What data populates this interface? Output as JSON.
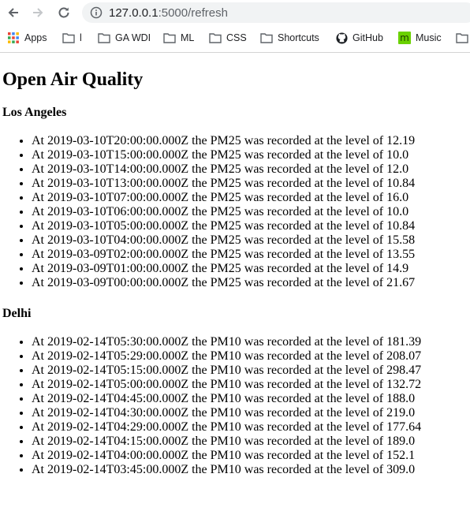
{
  "browser": {
    "url_host": "127.0.0.1",
    "url_path": ":5000/refresh",
    "bookmarks": [
      {
        "label": "Apps",
        "icon": "apps-grid-icon"
      },
      {
        "label": "l",
        "icon": "folder-icon"
      },
      {
        "label": "GA WDI",
        "icon": "folder-icon"
      },
      {
        "label": "ML",
        "icon": "folder-icon"
      },
      {
        "label": "CSS",
        "icon": "folder-icon"
      },
      {
        "label": "Shortcuts",
        "icon": "folder-icon"
      },
      {
        "label": "GitHub",
        "icon": "github-icon"
      },
      {
        "label": "Music",
        "icon": "music-m-icon"
      },
      {
        "label": "",
        "icon": "folder-icon"
      }
    ]
  },
  "page": {
    "title": "Open Air Quality",
    "cities": [
      {
        "name": "Los Angeles",
        "readings": [
          "At 2019-03-10T20:00:00.000Z the PM25 was recorded at the level of 12.19",
          "At 2019-03-10T15:00:00.000Z the PM25 was recorded at the level of 10.0",
          "At 2019-03-10T14:00:00.000Z the PM25 was recorded at the level of 12.0",
          "At 2019-03-10T13:00:00.000Z the PM25 was recorded at the level of 10.84",
          "At 2019-03-10T07:00:00.000Z the PM25 was recorded at the level of 16.0",
          "At 2019-03-10T06:00:00.000Z the PM25 was recorded at the level of 10.0",
          "At 2019-03-10T05:00:00.000Z the PM25 was recorded at the level of 10.84",
          "At 2019-03-10T04:00:00.000Z the PM25 was recorded at the level of 15.58",
          "At 2019-03-09T02:00:00.000Z the PM25 was recorded at the level of 13.55",
          "At 2019-03-09T01:00:00.000Z the PM25 was recorded at the level of 14.9",
          "At 2019-03-09T00:00:00.000Z the PM25 was recorded at the level of 21.67"
        ]
      },
      {
        "name": "Delhi",
        "readings": [
          "At 2019-02-14T05:30:00.000Z the PM10 was recorded at the level of 181.39",
          "At 2019-02-14T05:29:00.000Z the PM10 was recorded at the level of 208.07",
          "At 2019-02-14T05:15:00.000Z the PM10 was recorded at the level of 298.47",
          "At 2019-02-14T05:00:00.000Z the PM10 was recorded at the level of 132.72",
          "At 2019-02-14T04:45:00.000Z the PM10 was recorded at the level of 188.0",
          "At 2019-02-14T04:30:00.000Z the PM10 was recorded at the level of 219.0",
          "At 2019-02-14T04:29:00.000Z the PM10 was recorded at the level of 177.64",
          "At 2019-02-14T04:15:00.000Z the PM10 was recorded at the level of 189.0",
          "At 2019-02-14T04:00:00.000Z the PM10 was recorded at the level of 152.1",
          "At 2019-02-14T03:45:00.000Z the PM10 was recorded at the level of 309.0"
        ]
      }
    ]
  }
}
